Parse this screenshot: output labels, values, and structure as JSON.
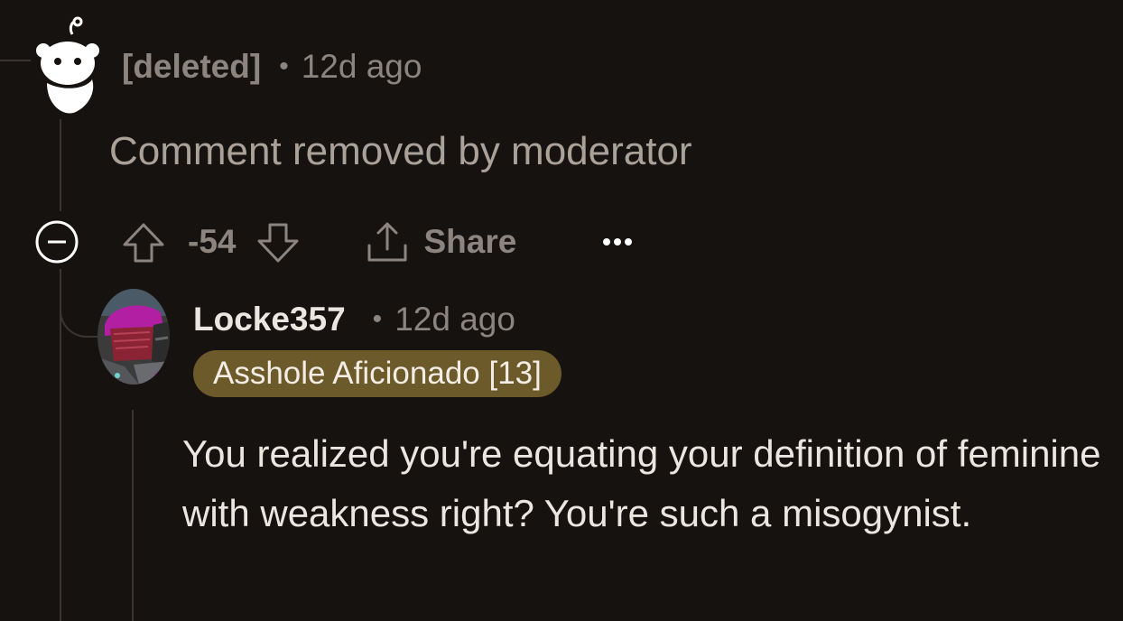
{
  "colors": {
    "background": "#161210",
    "text_primary": "#ece6e1",
    "text_muted": "#8c857f",
    "flair_background": "#6d5a2a"
  },
  "deleted_comment": {
    "author": "[deleted]",
    "separator": "•",
    "timestamp": "12d ago",
    "avatar_icon": "reddit-snoo-icon",
    "body": "Comment removed by moderator",
    "actions": {
      "collapse_icon": "minus-circle-icon",
      "upvote_icon": "upvote-arrow-icon",
      "score": "-54",
      "downvote_icon": "downvote-arrow-icon",
      "share_icon": "share-icon",
      "share_label": "Share",
      "more_icon": "ellipsis-icon"
    }
  },
  "reply": {
    "author": "Locke357",
    "separator": "•",
    "timestamp": "12d ago",
    "avatar_icon": "user-avatar-helmet",
    "flair": "Asshole Aficionado [13]",
    "body": "You realized you're equating your definition of feminine with weakness right? You're such a misogynist."
  }
}
